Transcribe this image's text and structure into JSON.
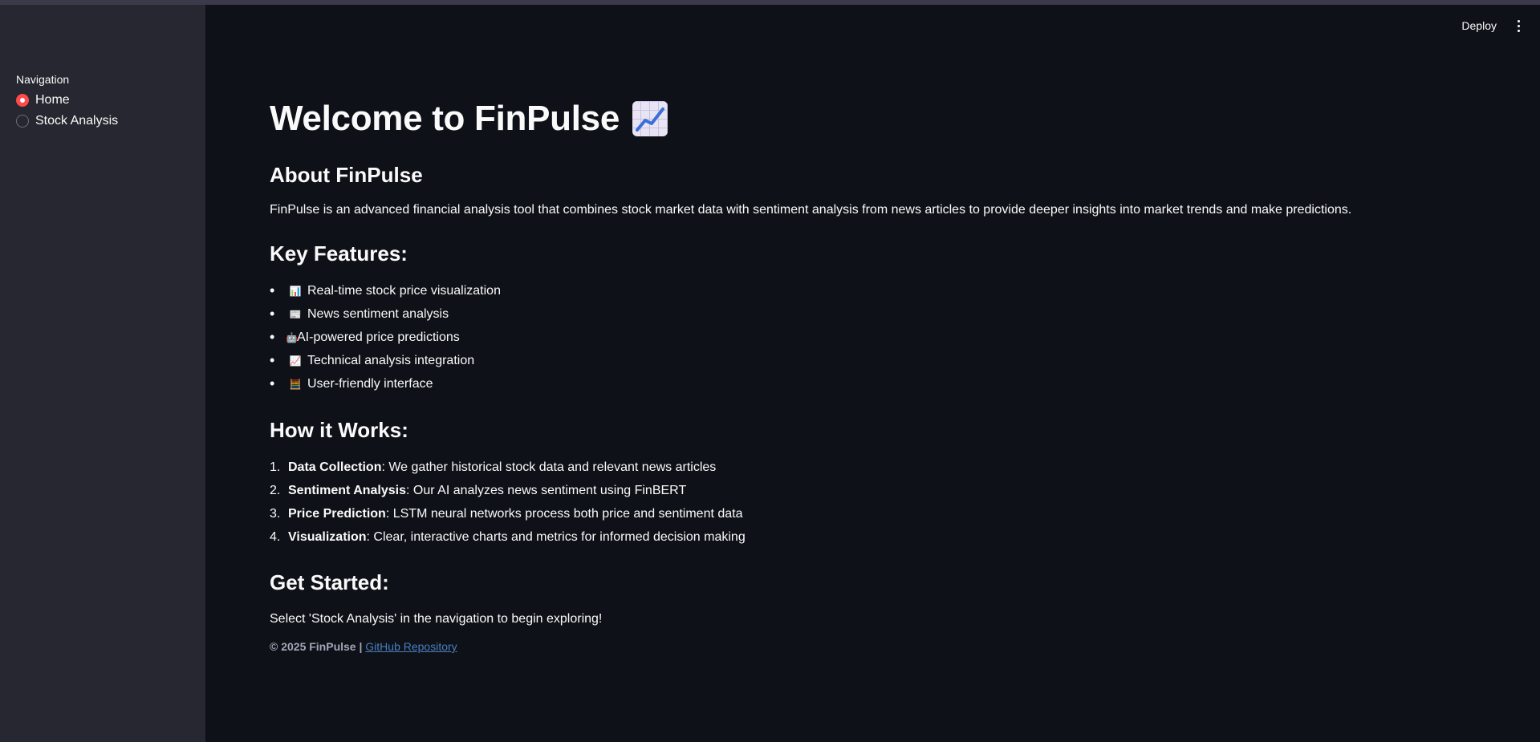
{
  "sidebar": {
    "nav_label": "Navigation",
    "options": [
      {
        "label": "Home",
        "selected": true
      },
      {
        "label": "Stock Analysis",
        "selected": false
      }
    ]
  },
  "header": {
    "deploy_label": "Deploy",
    "menu_icon": "kebab-menu-icon"
  },
  "main": {
    "title": "Welcome to FinPulse",
    "title_icon": "chart-increasing-icon",
    "about_heading": "About FinPulse",
    "about_text": "FinPulse is an advanced financial analysis tool that combines stock market data with sentiment analysis from news articles to provide deeper insights into market trends and make predictions.",
    "features_heading": "Key Features:",
    "features": [
      {
        "icon": "bar-chart-icon",
        "glyph": "📊",
        "label": "Real-time stock price visualization"
      },
      {
        "icon": "newspaper-icon",
        "glyph": "📰",
        "label": "News sentiment analysis"
      },
      {
        "icon": "robot-icon",
        "glyph": "🤖",
        "label": "AI-powered price predictions"
      },
      {
        "icon": "chart-increasing-icon",
        "glyph": "📈",
        "label": "Technical analysis integration"
      },
      {
        "icon": "abacus-icon",
        "glyph": "🧮",
        "label": "User-friendly interface"
      }
    ],
    "how_heading": "How it Works:",
    "steps": [
      {
        "num": "1.",
        "title": "Data Collection",
        "text": ": We gather historical stock data and relevant news articles"
      },
      {
        "num": "2.",
        "title": "Sentiment Analysis",
        "text": ": Our AI analyzes news sentiment using FinBERT"
      },
      {
        "num": "3.",
        "title": "Price Prediction",
        "text": ": LSTM neural networks process both price and sentiment data"
      },
      {
        "num": "4.",
        "title": "Visualization",
        "text": ": Clear, interactive charts and metrics for informed decision making"
      }
    ],
    "get_started_heading": "Get Started:",
    "get_started_text": "Select 'Stock Analysis' in the navigation to begin exploring!",
    "footer_text": "© 2025 FinPulse | ",
    "footer_link": "GitHub Repository"
  },
  "colors": {
    "background": "#0e1117",
    "sidebar": "#262730",
    "accent": "#ff4b4b",
    "link": "#4a7fc1"
  }
}
